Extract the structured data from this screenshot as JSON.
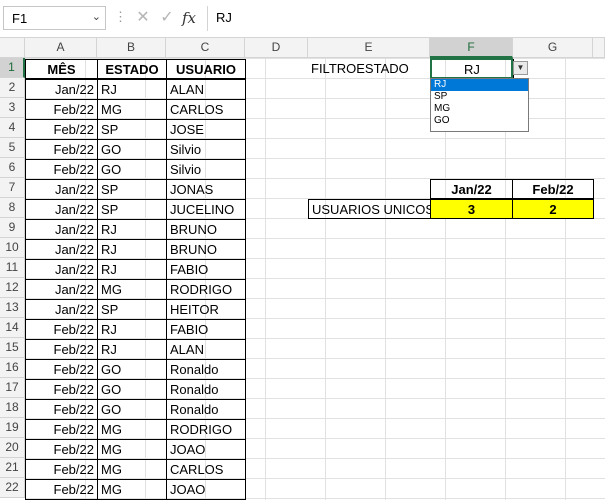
{
  "formula_bar": {
    "name_box": "F1",
    "formula": "RJ",
    "fx": "fx"
  },
  "columns": [
    "A",
    "B",
    "C",
    "D",
    "E",
    "F",
    "G"
  ],
  "rows": [
    "1",
    "2",
    "3",
    "4",
    "5",
    "6",
    "7",
    "8",
    "9",
    "10",
    "11",
    "12",
    "13",
    "14",
    "15",
    "16",
    "17",
    "18",
    "19",
    "20",
    "21",
    "22"
  ],
  "table": {
    "headers": [
      "MÊS",
      "ESTADO",
      "USUARIO"
    ],
    "rows": [
      [
        "Jan/22",
        "RJ",
        "ALAN"
      ],
      [
        "Feb/22",
        "MG",
        "CARLOS"
      ],
      [
        "Feb/22",
        "SP",
        "JOSE"
      ],
      [
        "Feb/22",
        "GO",
        "Silvio"
      ],
      [
        "Feb/22",
        "GO",
        "Silvio"
      ],
      [
        "Jan/22",
        "SP",
        "JONAS"
      ],
      [
        "Jan/22",
        "SP",
        "JUCELINO"
      ],
      [
        "Jan/22",
        "RJ",
        "BRUNO"
      ],
      [
        "Jan/22",
        "RJ",
        "BRUNO"
      ],
      [
        "Jan/22",
        "RJ",
        "FABIO"
      ],
      [
        "Jan/22",
        "MG",
        "RODRIGO"
      ],
      [
        "Jan/22",
        "SP",
        "HEITOR"
      ],
      [
        "Feb/22",
        "RJ",
        "FABIO"
      ],
      [
        "Feb/22",
        "RJ",
        "ALAN"
      ],
      [
        "Feb/22",
        "GO",
        "Ronaldo"
      ],
      [
        "Feb/22",
        "GO",
        "Ronaldo"
      ],
      [
        "Feb/22",
        "GO",
        "Ronaldo"
      ],
      [
        "Feb/22",
        "MG",
        "RODRIGO"
      ],
      [
        "Feb/22",
        "MG",
        "JOAO"
      ],
      [
        "Feb/22",
        "MG",
        "CARLOS"
      ],
      [
        "Feb/22",
        "MG",
        "JOAO"
      ]
    ]
  },
  "filter": {
    "label": "FILTROESTADO",
    "value": "RJ",
    "options": [
      "RJ",
      "SP",
      "MG",
      "GO"
    ]
  },
  "summary": {
    "months": [
      "Jan/22",
      "Feb/22"
    ],
    "label": "USUARIOS UNICOS",
    "values": [
      "3",
      "2"
    ]
  },
  "colors": {
    "highlight": "#ffff00",
    "selection": "#217346",
    "dropdown_selected": "#0078d7"
  }
}
